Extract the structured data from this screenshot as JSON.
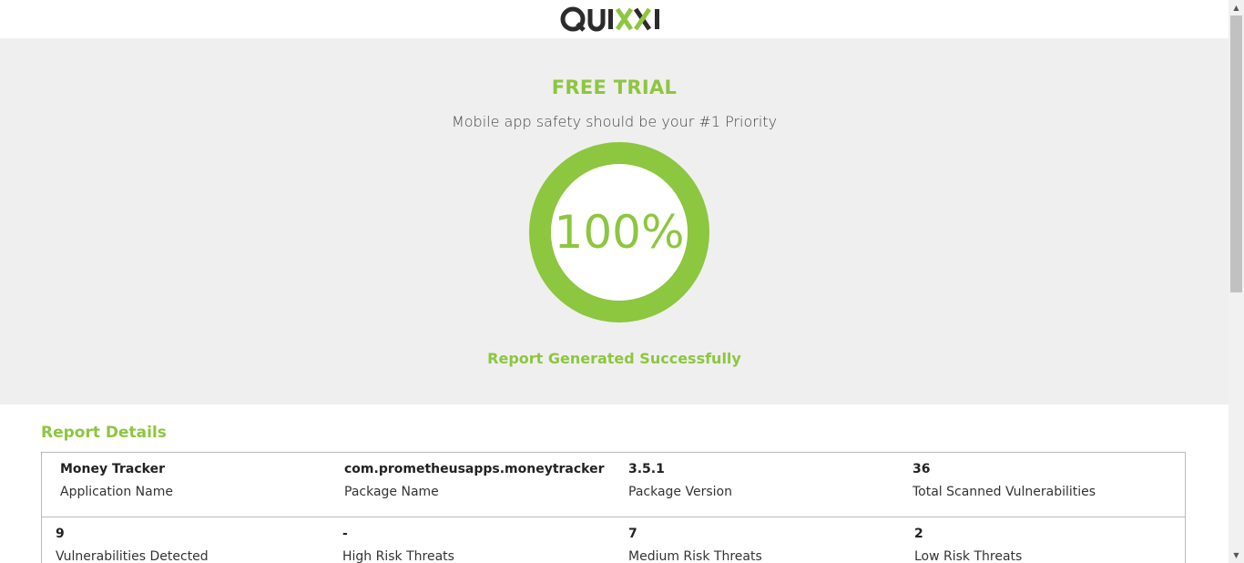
{
  "header": {
    "logo_text": "QUIXXI"
  },
  "hero": {
    "title": "FREE TRIAL",
    "subtitle": "Mobile app safety should be your #1 Priority",
    "progress_label": "100%",
    "progress_fraction": 1.0,
    "status": "Report Generated Successfully"
  },
  "details": {
    "heading": "Report Details",
    "rows": [
      [
        {
          "value": "Money Tracker",
          "label": "Application Name"
        },
        {
          "value": "com.prometheusapps.moneytracker",
          "label": "Package Name"
        },
        {
          "value": "3.5.1",
          "label": "Package Version"
        },
        {
          "value": "36",
          "label": "Total Scanned Vulnerabilities"
        }
      ],
      [
        {
          "value": "9",
          "label": "Vulnerabilities Detected"
        },
        {
          "value": "-",
          "label": "High Risk Threats"
        },
        {
          "value": "7",
          "label": "Medium Risk Threats"
        },
        {
          "value": "2",
          "label": "Low Risk Threats"
        }
      ]
    ]
  },
  "colors": {
    "accent": "#8dc63f",
    "logo_dark": "#2b2b2b",
    "hero_bg": "#efefef"
  },
  "icons": {
    "scroll_up": "scroll-up-arrow-icon",
    "scroll_down": "scroll-down-arrow-icon"
  }
}
